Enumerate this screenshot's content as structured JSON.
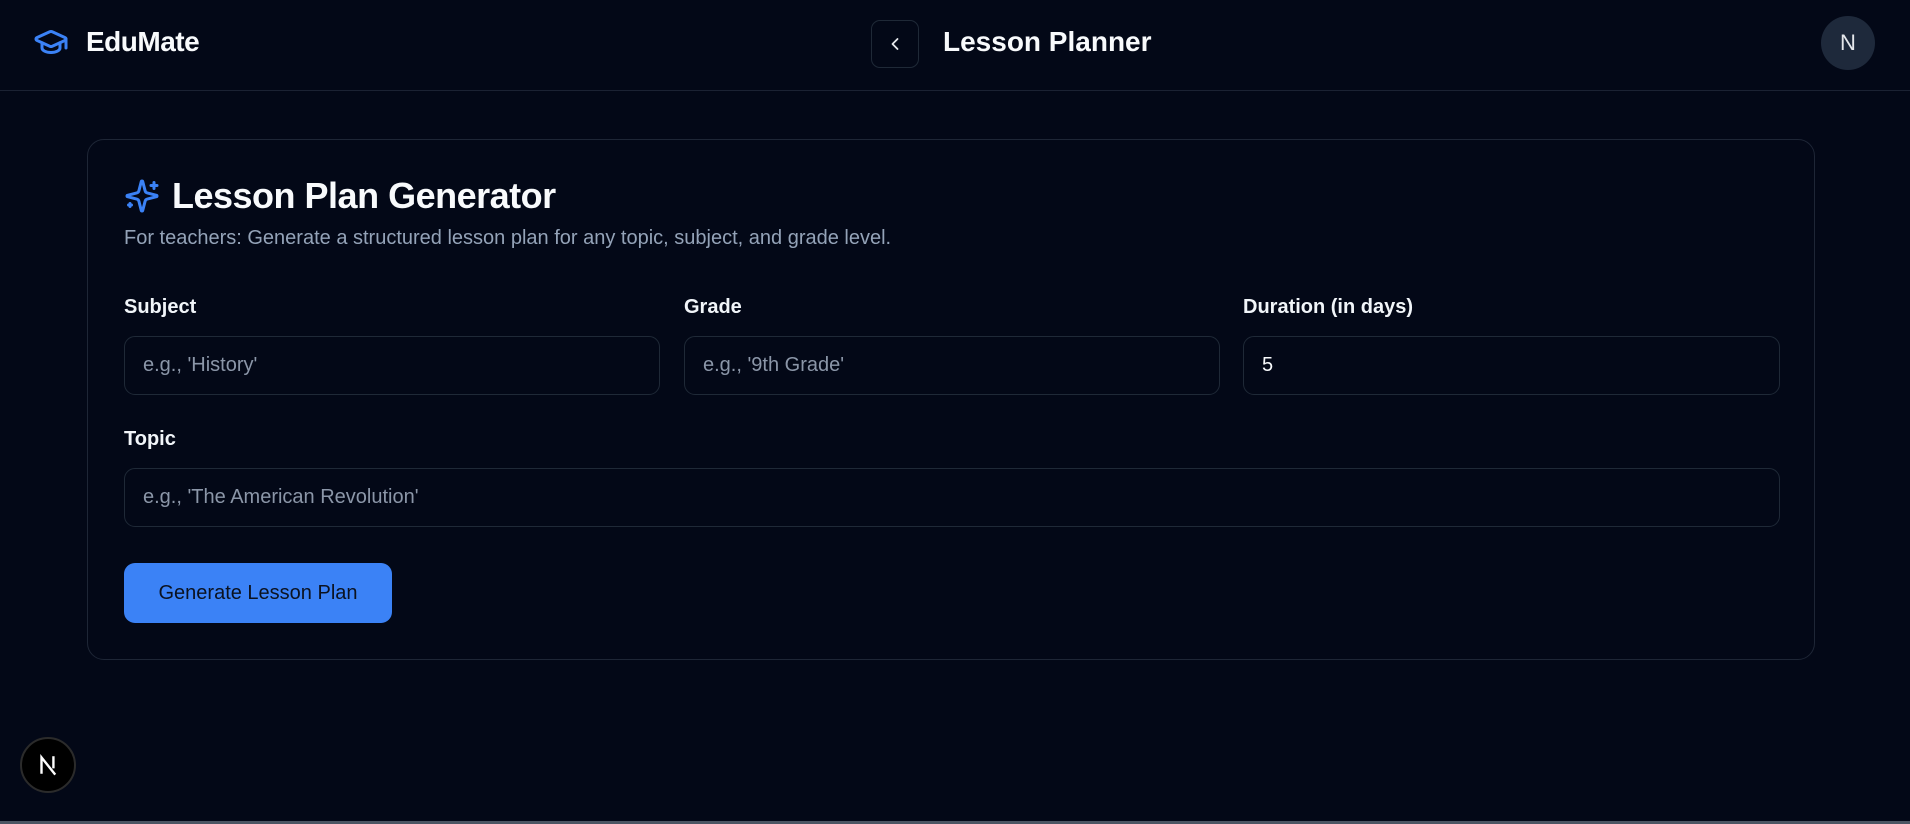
{
  "header": {
    "brand_name": "EduMate",
    "page_title": "Lesson Planner",
    "avatar_initial": "N"
  },
  "card": {
    "title": "Lesson Plan Generator",
    "subtitle": "For teachers: Generate a structured lesson plan for any topic, subject, and grade level."
  },
  "form": {
    "subject": {
      "label": "Subject",
      "placeholder": "e.g., 'History'",
      "value": ""
    },
    "grade": {
      "label": "Grade",
      "placeholder": "e.g., '9th Grade'",
      "value": ""
    },
    "duration": {
      "label": "Duration (in days)",
      "placeholder": "",
      "value": "5"
    },
    "topic": {
      "label": "Topic",
      "placeholder": "e.g., 'The American Revolution'",
      "value": ""
    },
    "submit_label": "Generate Lesson Plan"
  },
  "icons": {
    "brand": "graduation-cap-icon",
    "back": "chevron-left-icon",
    "title": "sparkles-icon",
    "dev_badge": "nextjs-icon"
  },
  "colors": {
    "background": "#030817",
    "accent": "#3b82f6",
    "muted_text": "#94a3b8",
    "border": "#1f2937"
  }
}
